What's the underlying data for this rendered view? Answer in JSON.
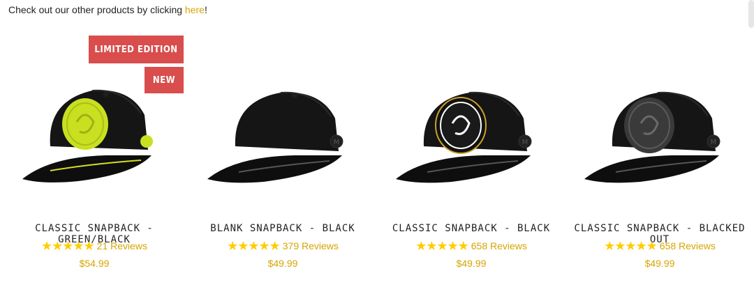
{
  "intro": {
    "text_before": "Check out our other products by clicking ",
    "link_text": "here",
    "text_after": "!"
  },
  "colors": {
    "accent": "#d6a500",
    "star": "#ffcc00",
    "badge": "#d94d4d"
  },
  "products": [
    {
      "title": "CLASSIC SNAPBACK - GREEN/BLACK",
      "rating_stars": "★★★★★",
      "reviews": "21 Reviews",
      "price": "$54.99",
      "badges": [
        "LIMITED EDITION",
        "NEW"
      ]
    },
    {
      "title": "BLANK SNAPBACK - BLACK",
      "rating_stars": "★★★★★",
      "reviews": "379 Reviews",
      "price": "$49.99"
    },
    {
      "title": "CLASSIC SNAPBACK - BLACK",
      "rating_stars": "★★★★★",
      "reviews": "658 Reviews",
      "price": "$49.99"
    },
    {
      "title": "CLASSIC SNAPBACK - BLACKED OUT",
      "rating_stars": "★★★★★",
      "reviews": "658 Reviews",
      "price": "$49.99"
    }
  ]
}
